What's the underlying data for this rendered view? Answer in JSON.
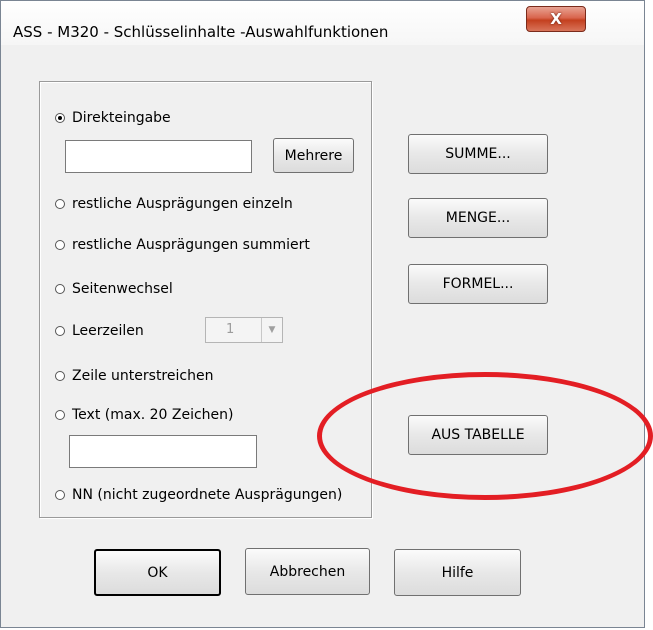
{
  "window": {
    "title": "ASS - M320 - Schlüsselinhalte -Auswahlfunktionen",
    "close_label": "X"
  },
  "options": {
    "direkteingabe": "Direkteingabe",
    "mehrere_button": "Mehrere",
    "einzeln": "restliche Ausprägungen einzeln",
    "summiert": "restliche Ausprägungen summiert",
    "seitenwechsel": "Seitenwechsel",
    "leerzeilen": "Leerzeilen",
    "leerzeilen_value": "1",
    "unterstreichen": "Zeile unterstreichen",
    "text": "Text (max. 20 Zeichen)",
    "nn": "NN (nicht zugeordnete Ausprägungen)",
    "selected": "direkteingabe"
  },
  "side_buttons": {
    "summe": "SUMME...",
    "menge": "MENGE...",
    "formel": "FORMEL...",
    "aus_tabelle": "AUS TABELLE"
  },
  "footer": {
    "ok": "OK",
    "abbrechen": "Abbrechen",
    "hilfe": "Hilfe"
  },
  "colors": {
    "annotation": "#e31e24",
    "close_button": "#c4401f"
  },
  "icons": {
    "combo_arrow": "chevron-down-icon",
    "close": "close-icon"
  }
}
